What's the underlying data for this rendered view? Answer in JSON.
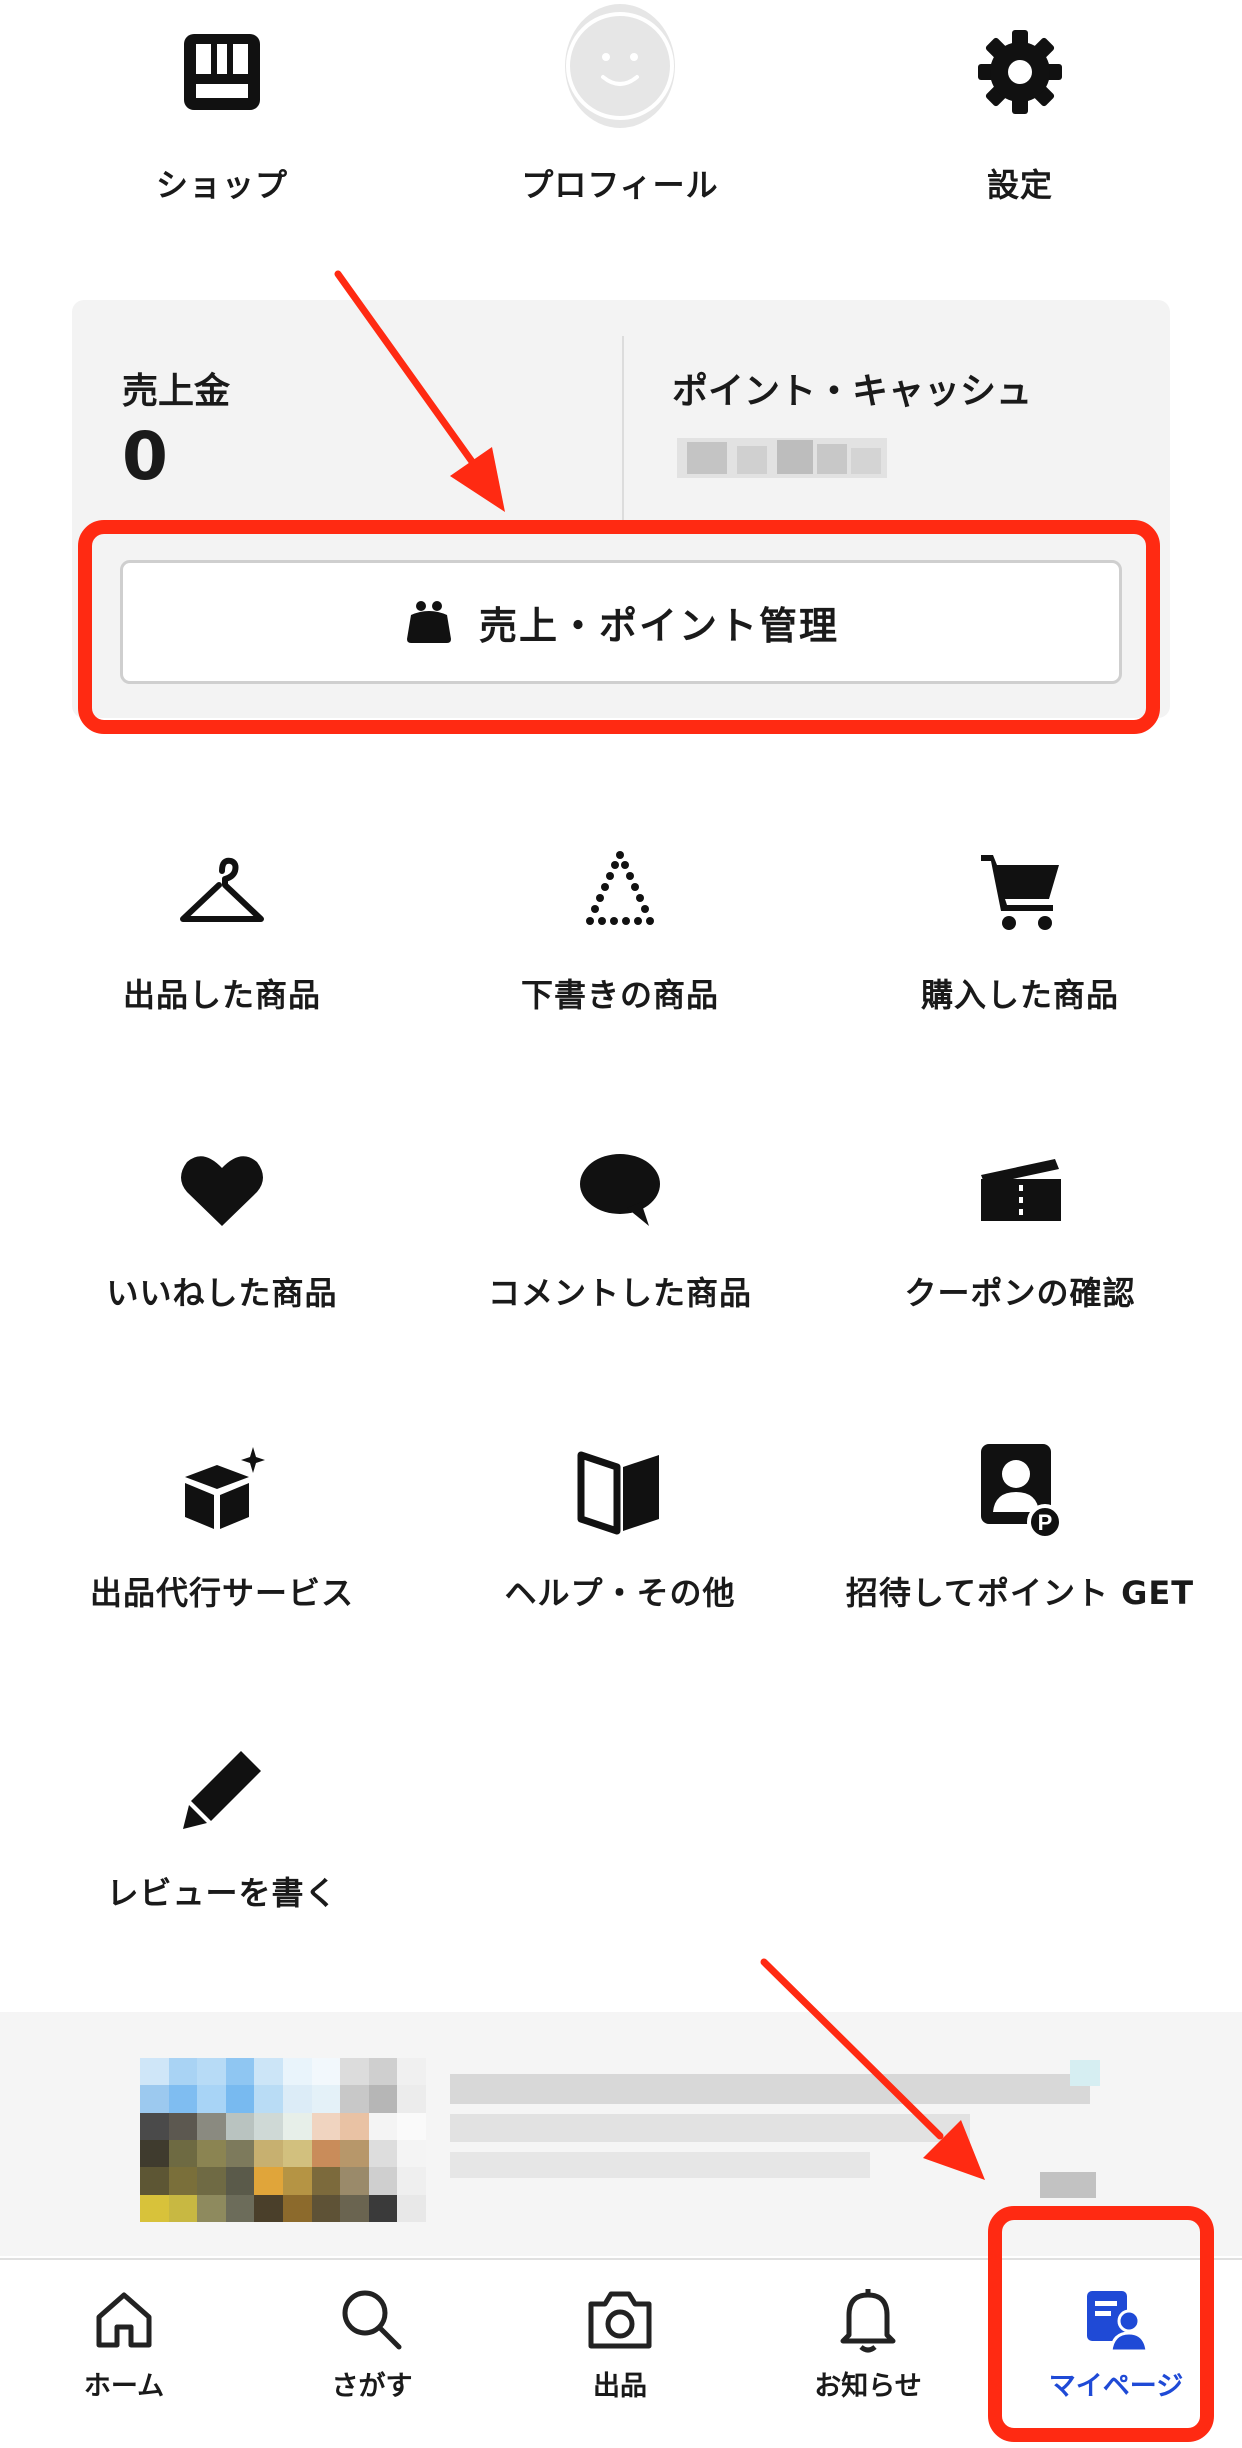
{
  "top_row": {
    "shop_label": "ショップ",
    "profile_label": "プロフィール",
    "settings_label": "設定"
  },
  "balance": {
    "sales_label": "売上金",
    "sales_value": "0",
    "points_label": "ポイント・キャッシュ",
    "manage_button_label": "売上・ポイント管理"
  },
  "menu": {
    "items": [
      {
        "label": "出品した商品",
        "icon": "hanger-icon"
      },
      {
        "label": "下書きの商品",
        "icon": "draft-triangle-icon"
      },
      {
        "label": "購入した商品",
        "icon": "cart-icon"
      },
      {
        "label": "いいねした商品",
        "icon": "heart-icon"
      },
      {
        "label": "コメントした商品",
        "icon": "comment-icon"
      },
      {
        "label": "クーポンの確認",
        "icon": "coupon-icon"
      },
      {
        "label": "出品代行サービス",
        "icon": "box-sparkle-icon"
      },
      {
        "label": "ヘルプ・その他",
        "icon": "book-icon"
      },
      {
        "label": "招待してポイント GET",
        "icon": "invite-point-icon"
      },
      {
        "label": "レビューを書く",
        "icon": "pencil-icon"
      }
    ]
  },
  "bottom_nav": {
    "items": [
      {
        "label": "ホーム",
        "icon": "home-icon"
      },
      {
        "label": "さがす",
        "icon": "search-icon"
      },
      {
        "label": "出品",
        "icon": "camera-icon"
      },
      {
        "label": "お知らせ",
        "icon": "bell-icon"
      },
      {
        "label": "マイページ",
        "icon": "mypage-icon"
      }
    ],
    "active_index": 4
  },
  "colors": {
    "accent_blue": "#1f4ad6",
    "annotation_red": "#ff2a12",
    "card_bg": "#f3f3f3"
  }
}
